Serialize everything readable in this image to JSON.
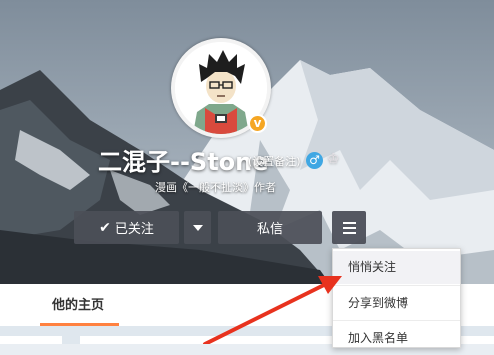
{
  "profile": {
    "name": "二混子--Stone",
    "remark_label": "(设置备注)",
    "description": "漫画《一般不扯淡》作者",
    "verified_icon": "verified-v-icon",
    "gender_icon": "male-icon",
    "member_icon": "crown-icon"
  },
  "actions": {
    "follow_label": "已关注",
    "message_label": "私信"
  },
  "tabs": {
    "home_label": "他的主页"
  },
  "dropdown": {
    "items": [
      {
        "label": "悄悄关注"
      },
      {
        "label": "分享到微博"
      },
      {
        "label": "加入黑名单"
      }
    ]
  },
  "colors": {
    "accent": "#ff8140",
    "button_bg": "#4c4f58",
    "arrow": "#e8321e",
    "verified": "#f5a623",
    "gender": "#3fa7e3"
  }
}
